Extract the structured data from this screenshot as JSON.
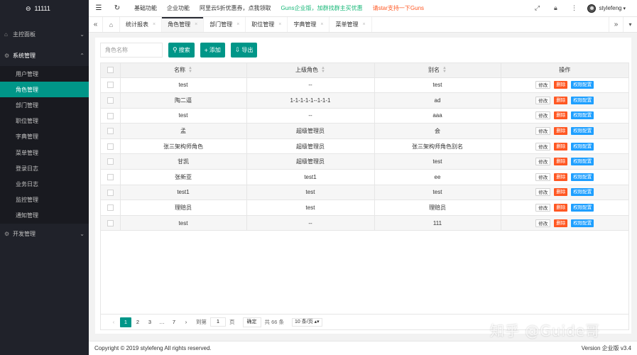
{
  "app": {
    "logo_text": "11111"
  },
  "sidebar": {
    "groups": [
      {
        "label": "主控面板",
        "icon": "home-icon"
      },
      {
        "label": "系统管理",
        "icon": "gear-icon"
      },
      {
        "label": "开发管理",
        "icon": "code-icon"
      }
    ],
    "items": [
      {
        "label": "用户管理"
      },
      {
        "label": "角色管理"
      },
      {
        "label": "部门管理"
      },
      {
        "label": "职位管理"
      },
      {
        "label": "字典管理"
      },
      {
        "label": "菜单管理"
      },
      {
        "label": "登录日志"
      },
      {
        "label": "业务日志"
      },
      {
        "label": "监控管理"
      },
      {
        "label": "通知管理"
      }
    ]
  },
  "header": {
    "links": [
      "基础功能",
      "企业功能",
      "阿里云5折优惠券，点我领取",
      "Guns企业版，加群找群主买优惠",
      "请star支持一下Guns"
    ],
    "user": "stylefeng",
    "colors": {
      "green": "#16b777",
      "orange": "#ff5722"
    }
  },
  "tabs": [
    "统计报表",
    "角色管理",
    "部门管理",
    "职位管理",
    "字典管理",
    "菜单管理"
  ],
  "toolbar": {
    "search_placeholder": "角色名称",
    "search_label": "搜索",
    "add_label": "添加",
    "export_label": "导出"
  },
  "table": {
    "columns": [
      "名称",
      "上级角色",
      "别名",
      "操作"
    ],
    "rows": [
      [
        "test",
        "--",
        "test"
      ],
      [
        "陶二逼",
        "1-1-1-1-1--1-1-1",
        "ad"
      ],
      [
        "test",
        "--",
        "aaa"
      ],
      [
        "孟",
        "超级管理员",
        "会"
      ],
      [
        "张三架构师角色",
        "超级管理员",
        "张三架构师角色别名"
      ],
      [
        "甘凯",
        "超级管理员",
        "test"
      ],
      [
        "张新亚",
        "test1",
        "ee"
      ],
      [
        "test1",
        "test",
        "test"
      ],
      [
        "理赔员",
        "test",
        "理赔员"
      ],
      [
        "test",
        "--",
        "111"
      ]
    ],
    "actions": {
      "edit": "修改",
      "delete": "删除",
      "perm": "权限配置"
    }
  },
  "pager": {
    "pages": [
      "1",
      "2",
      "3",
      "…",
      "7"
    ],
    "goto_label": "到第",
    "goto_value": "1",
    "page_unit": "页",
    "confirm": "确定",
    "total": "共 66 条",
    "per_page": "10 条/页"
  },
  "footer": {
    "copyright": "Copyright © 2019 stylefeng All rights reserved.",
    "version": "Version 企业版 v3.4"
  },
  "watermark": "知乎 @Guide哥",
  "theme": {
    "accent": "#009688",
    "sidebar_bg": "#20222a",
    "danger": "#ff5722",
    "info": "#1e9fff"
  }
}
